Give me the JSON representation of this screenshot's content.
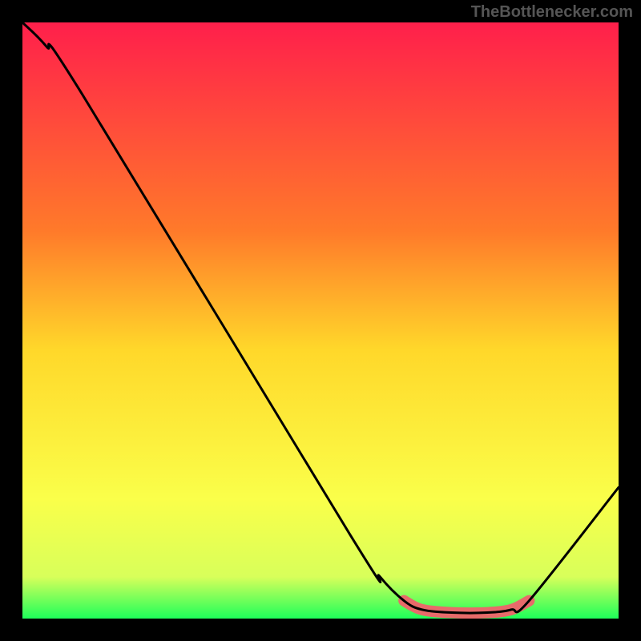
{
  "watermark": "TheBottlenecker.com",
  "chart_data": {
    "type": "line",
    "xlabel": "",
    "ylabel": "",
    "xlim": [
      0,
      100
    ],
    "ylim": [
      0,
      100
    ],
    "series": [
      {
        "name": "curve",
        "points": [
          {
            "x": 0,
            "y": 100
          },
          {
            "x": 4,
            "y": 96
          },
          {
            "x": 10,
            "y": 88
          },
          {
            "x": 55,
            "y": 14
          },
          {
            "x": 60,
            "y": 7
          },
          {
            "x": 64,
            "y": 3
          },
          {
            "x": 67,
            "y": 1.5
          },
          {
            "x": 72,
            "y": 1
          },
          {
            "x": 78,
            "y": 1
          },
          {
            "x": 82,
            "y": 1.5
          },
          {
            "x": 85,
            "y": 3
          },
          {
            "x": 100,
            "y": 22
          }
        ]
      }
    ],
    "highlight_range_x": [
      64,
      85
    ],
    "gradient_stops": [
      {
        "offset": 0,
        "color": "#ff1f4b"
      },
      {
        "offset": 0.35,
        "color": "#ff7a2a"
      },
      {
        "offset": 0.55,
        "color": "#ffd82a"
      },
      {
        "offset": 0.8,
        "color": "#faff4a"
      },
      {
        "offset": 0.93,
        "color": "#d8ff5a"
      },
      {
        "offset": 1.0,
        "color": "#1eff5a"
      }
    ]
  }
}
